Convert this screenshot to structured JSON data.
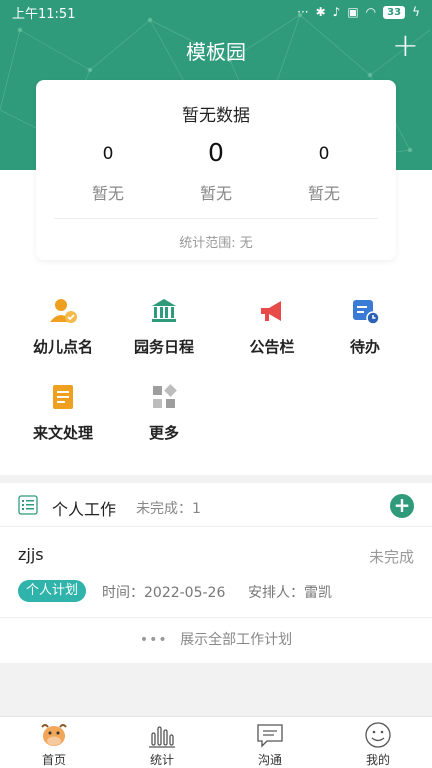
{
  "status_bar": {
    "time": "上午11:51",
    "battery": "33"
  },
  "header": {
    "title": "模板园"
  },
  "summary": {
    "title": "暂无数据",
    "stats": [
      {
        "value": "0",
        "label": "暂无"
      },
      {
        "value": "0",
        "label": "暂无"
      },
      {
        "value": "0",
        "label": "暂无"
      }
    ],
    "range": "统计范围: 无"
  },
  "grid": [
    {
      "label": "幼儿点名",
      "icon": "child-roll-call-icon",
      "color": "#f0a020"
    },
    {
      "label": "园务日程",
      "icon": "institution-icon",
      "color": "#2f9b7a"
    },
    {
      "label": "公告栏",
      "icon": "megaphone-icon",
      "color": "#e84a4a"
    },
    {
      "label": "待办",
      "icon": "todo-icon",
      "color": "#3a7bd5"
    },
    {
      "label": "来文处理",
      "icon": "document-icon",
      "color": "#f0a020"
    },
    {
      "label": "更多",
      "icon": "more-grid-icon",
      "color": "#9e9e9e"
    }
  ],
  "work": {
    "title": "个人工作",
    "subtitle": "未完成：1",
    "task": {
      "name": "zjjs",
      "status": "未完成",
      "tag": "个人计划",
      "time": "时间：2022-05-26",
      "assignee": "安排人：雷凯"
    },
    "show_all": "展示全部工作计划"
  },
  "tabs": [
    {
      "label": "首页",
      "icon": "cow-home-icon"
    },
    {
      "label": "统计",
      "icon": "bar-chart-icon"
    },
    {
      "label": "沟通",
      "icon": "chat-icon"
    },
    {
      "label": "我的",
      "icon": "smile-profile-icon"
    }
  ],
  "colors": {
    "brand": "#2f9b7a",
    "tag": "#2fb3aa"
  }
}
